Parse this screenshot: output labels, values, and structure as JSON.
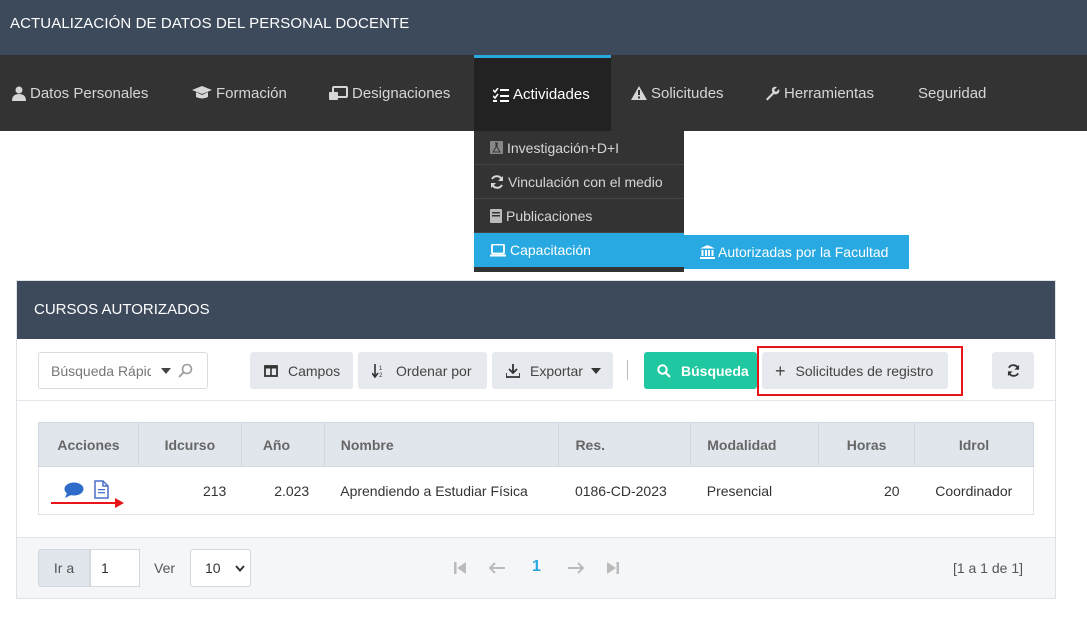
{
  "app": {
    "title": "ACTUALIZACIÓN DE DATOS DEL PERSONAL DOCENTE"
  },
  "nav": {
    "items": [
      {
        "label": "Datos Personales",
        "icon": "user-icon"
      },
      {
        "label": "Formación",
        "icon": "graduation-cap-icon"
      },
      {
        "label": "Designaciones",
        "icon": "laptop-icon"
      },
      {
        "label": "Actividades",
        "icon": "list-icon",
        "active": true
      },
      {
        "label": "Solicitudes",
        "icon": "warning-icon"
      },
      {
        "label": "Herramientas",
        "icon": "wrench-icon"
      },
      {
        "label": "Seguridad",
        "icon": ""
      }
    ],
    "dropdown": [
      {
        "label": "Investigación+D+I",
        "icon": "flask-icon"
      },
      {
        "label": "Vinculación con el medio",
        "icon": "refresh-icon"
      },
      {
        "label": "Publicaciones",
        "icon": "book-icon"
      },
      {
        "label": "Capacitación",
        "icon": "laptop-icon",
        "active": true
      }
    ],
    "submenu": {
      "label": "Autorizadas por la Facultad",
      "icon": "institution-icon"
    }
  },
  "panel": {
    "title": "CURSOS AUTORIZADOS",
    "toolbar": {
      "search_placeholder": "Búsqueda Rápida",
      "campos": "Campos",
      "ordenar": "Ordenar por",
      "exportar": "Exportar",
      "busqueda": "Búsqueda",
      "solicitudes": "Solicitudes de registro"
    },
    "table": {
      "headers": [
        "Acciones",
        "Idcurso",
        "Año",
        "Nombre",
        "Res.",
        "Modalidad",
        "Horas",
        "Idrol"
      ],
      "rows": [
        {
          "idcurso": "213",
          "anio": "2.023",
          "nombre": "Aprendiendo a Estudiar Física",
          "res": "0186-CD-2023",
          "modalidad": "Presencial",
          "horas": "20",
          "idrol": "Coordinador"
        }
      ]
    },
    "footer": {
      "ir_a": "Ir a",
      "page_value": "1",
      "ver": "Ver",
      "page_size": "10",
      "current_page": "1",
      "count": "[1 a 1 de 1]"
    }
  },
  "colors": {
    "header": "#3d4a5c",
    "nav": "#333333",
    "accent": "#29a9e1",
    "search_btn": "#1fc8a0",
    "highlight": "#e8141a"
  }
}
